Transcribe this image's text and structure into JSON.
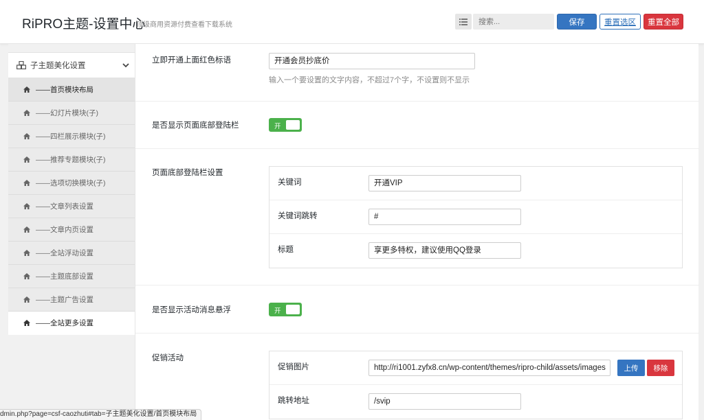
{
  "header": {
    "title": "RiPRO主题-设置中心",
    "subtitle": "顶级商用资源付费查看下载系统",
    "search_placeholder": "搜索...",
    "save_label": "保存",
    "reset_section_label": "重置选区",
    "reset_all_label": "重置全部"
  },
  "sidebar": {
    "parent_label": "子主题美化设置",
    "items": [
      {
        "label": "——首页模块布局"
      },
      {
        "label": "——幻灯片模块(子)"
      },
      {
        "label": "——四栏展示模块(子)"
      },
      {
        "label": "——推荐专题模块(子)"
      },
      {
        "label": "——选项切换模块(子)"
      },
      {
        "label": "——文章列表设置"
      },
      {
        "label": "——文章内页设置"
      },
      {
        "label": "——全站浮动设置"
      },
      {
        "label": "——主题底部设置"
      },
      {
        "label": "——主题广告设置"
      },
      {
        "label": "——全站更多设置"
      }
    ]
  },
  "main": {
    "red_slogan": {
      "label": "立即开通上面红色标语",
      "value": "开通会员抄底价",
      "hint": "输入一个要设置的文字内容，不超过7个字，不设置则不显示"
    },
    "footer_login": {
      "label": "是否显示页面底部登陆栏",
      "switch_text": "开"
    },
    "footer_login_settings": {
      "label": "页面底部登陆栏设置",
      "fields": [
        {
          "label": "关键词",
          "value": "开通VIP"
        },
        {
          "label": "关键词跳转",
          "value": "#"
        },
        {
          "label": "标题",
          "value": "享更多特权，建议使用QQ登录"
        }
      ]
    },
    "activity_float": {
      "label": "是否显示活动消息悬浮",
      "switch_text": "开"
    },
    "promotion": {
      "label": "促销活动",
      "image_label": "促销图片",
      "image_url": "http://ri1001.zyfx8.cn/wp-content/themes/ripro-child/assets/images",
      "upload_label": "上传",
      "remove_label": "移除",
      "link_label": "跳转地址",
      "link_value": "/svip"
    }
  },
  "statusbar": {
    "text": "dmin.php?page=csf-caozhuti#tab=子主题美化设置/首页模块布局"
  },
  "colors": {
    "primary": "#3575c1",
    "danger": "#d9363e",
    "switch_on": "#4bb14b"
  }
}
